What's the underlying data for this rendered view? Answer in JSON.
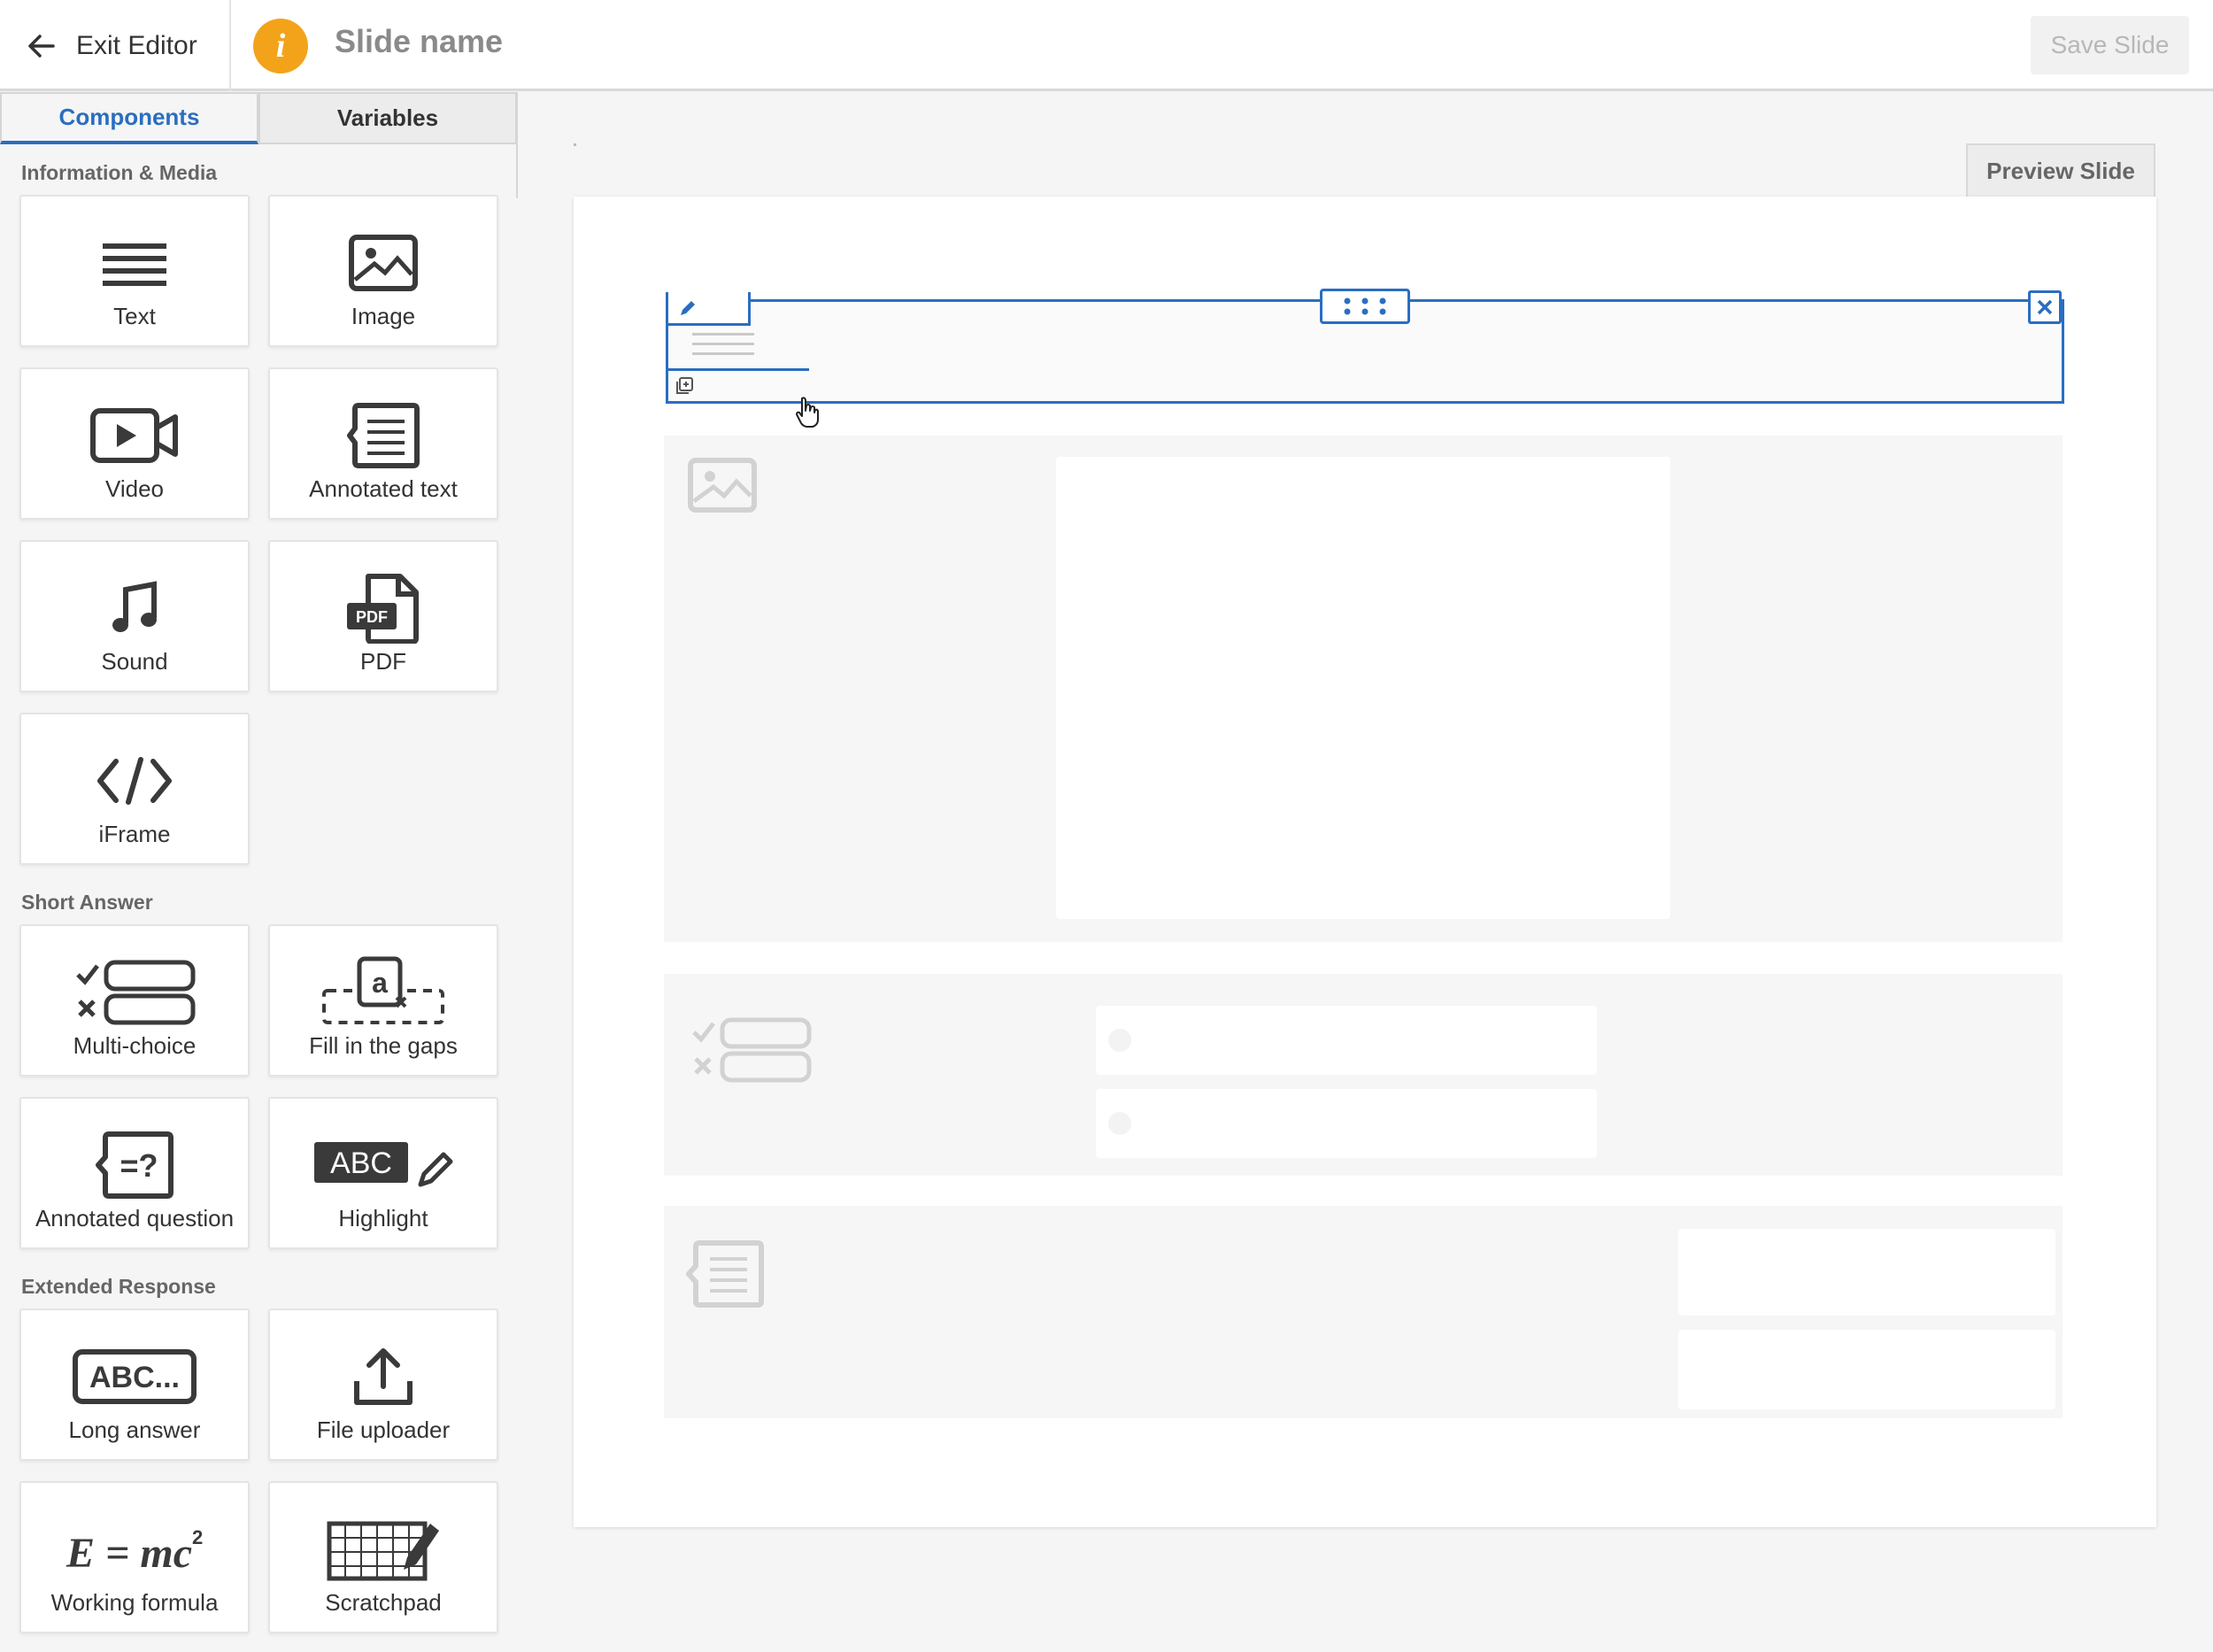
{
  "topbar": {
    "exit_label": "Exit Editor",
    "slide_name": "Slide name",
    "save_label": "Save Slide",
    "info_glyph": "i",
    "accent_color": "#f3a31a"
  },
  "sidebar": {
    "tabs": [
      {
        "label": "Components",
        "active": true
      },
      {
        "label": "Variables",
        "active": false
      }
    ],
    "sections": [
      {
        "title": "Information & Media",
        "items": [
          {
            "label": "Text",
            "icon": "text-lines-icon"
          },
          {
            "label": "Image",
            "icon": "image-icon"
          },
          {
            "label": "Video",
            "icon": "video-icon"
          },
          {
            "label": "Annotated text",
            "icon": "annotated-text-icon"
          },
          {
            "label": "Sound",
            "icon": "music-note-icon"
          },
          {
            "label": "PDF",
            "icon": "pdf-icon"
          },
          {
            "label": "iFrame",
            "icon": "code-icon"
          }
        ]
      },
      {
        "title": "Short Answer",
        "items": [
          {
            "label": "Multi-choice",
            "icon": "multi-choice-icon"
          },
          {
            "label": "Fill in the gaps",
            "icon": "fill-gaps-icon"
          },
          {
            "label": "Annotated question",
            "icon": "annotated-question-icon"
          },
          {
            "label": "Highlight",
            "icon": "highlight-icon"
          }
        ]
      },
      {
        "title": "Extended Response",
        "items": [
          {
            "label": "Long answer",
            "icon": "long-answer-icon"
          },
          {
            "label": "File uploader",
            "icon": "upload-icon"
          },
          {
            "label": "Working formula",
            "icon": "formula-icon"
          },
          {
            "label": "Scratchpad",
            "icon": "scratchpad-icon"
          }
        ]
      }
    ],
    "icon_text": {
      "pdf": "PDF",
      "fill_gaps": "a",
      "highlight": "ABC",
      "long_answer": "ABC...",
      "formula": "E = mc",
      "formula_sup": "2",
      "question": "=?"
    }
  },
  "canvas": {
    "preview_label": "Preview Slide",
    "selection_color": "#2a6ec0"
  }
}
